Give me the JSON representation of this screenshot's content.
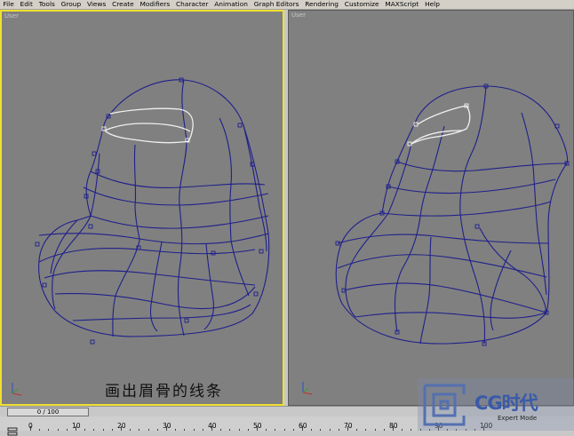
{
  "menu": [
    "File",
    "Edit",
    "Tools",
    "Group",
    "Views",
    "Create",
    "Modifiers",
    "Character",
    "Animation",
    "Graph Editors",
    "Rendering",
    "Customize",
    "MAXScript",
    "Help"
  ],
  "viewports": {
    "left": {
      "label": "User"
    },
    "right": {
      "label": "User"
    }
  },
  "caption": "画出眉骨的线条",
  "timeline": {
    "slider_text": "0 / 100",
    "ticks": [
      "0",
      "10",
      "20",
      "30",
      "40",
      "50",
      "60",
      "70",
      "80",
      "90",
      "100"
    ]
  },
  "watermark": {
    "brand": "CG时代",
    "sub_text": "Expert Mode"
  },
  "colors": {
    "wire": "#1f1f8c",
    "selected": "#f0f0f0",
    "active_border": "#f0e030"
  }
}
